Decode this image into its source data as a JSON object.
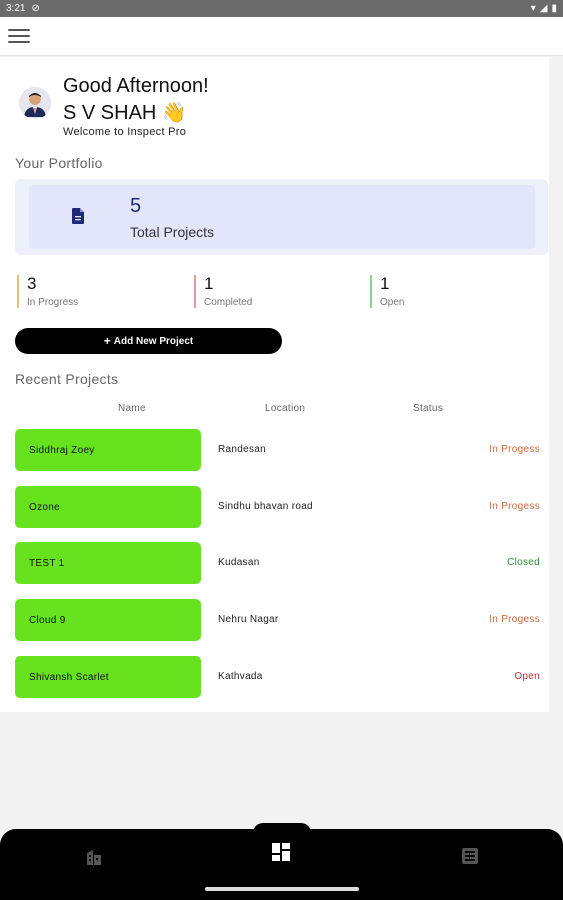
{
  "status_bar": {
    "time": "3:21"
  },
  "header": {
    "greeting": "Good Afternoon!",
    "user_name": "S V SHAH 👋",
    "welcome": "Welcome to Inspect Pro"
  },
  "portfolio": {
    "title": "Your Portfolio",
    "total_value": "5",
    "total_label": "Total Projects",
    "stats": [
      {
        "value": "3",
        "label": "In Progress",
        "color": "#f0c070"
      },
      {
        "value": "1",
        "label": "Completed",
        "color": "#e89a9a"
      },
      {
        "value": "1",
        "label": "Open",
        "color": "#8fcf8f"
      }
    ]
  },
  "add_project_label": "Add New Project",
  "recent": {
    "title": "Recent Projects",
    "columns": [
      "Name",
      "Location",
      "Status"
    ],
    "rows": [
      {
        "name": "Siddhraj Zoey",
        "location": "Randesan",
        "status": "In Progess",
        "status_color": "#c8683c"
      },
      {
        "name": "Ozone",
        "location": "Sindhu bhavan road",
        "status": "In Progess",
        "status_color": "#c8683c"
      },
      {
        "name": "TEST 1",
        "location": "Kudasan",
        "status": "Closed",
        "status_color": "#2e8b3a"
      },
      {
        "name": "Cloud 9",
        "location": "Nehru Nagar",
        "status": "In Progess",
        "status_color": "#c8683c"
      },
      {
        "name": "Shivansh Scarlet",
        "location": "Kathvada",
        "status": "Open",
        "status_color": "#d23030"
      }
    ]
  },
  "colors": {
    "accent_green": "#66e31e",
    "card_bg": "#e3e5fb",
    "total_value": "#1f2a7a"
  },
  "icons": {
    "menu": "hamburger-icon",
    "document": "document-icon",
    "nav": [
      "building-icon",
      "dashboard-icon",
      "list-icon"
    ]
  }
}
